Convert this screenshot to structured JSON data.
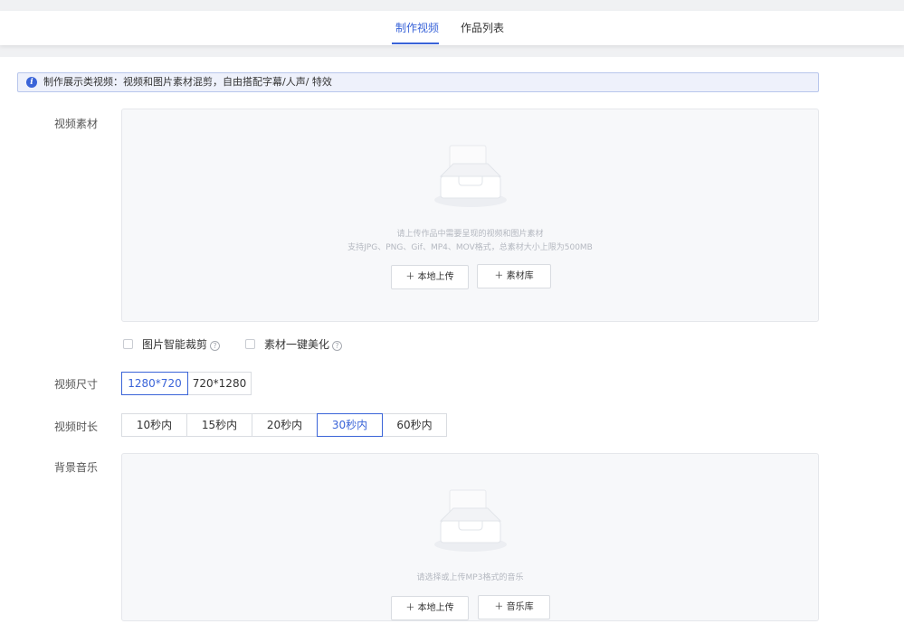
{
  "tabs": [
    {
      "label": "制作视频",
      "active": true
    },
    {
      "label": "作品列表",
      "active": false
    }
  ],
  "notice": {
    "text": "制作展示类视频：视频和图片素材混剪，自由搭配字幕/人声/ 特效",
    "icon": "info-icon"
  },
  "video_material": {
    "label": "视频素材",
    "hint_line1": "请上传作品中需要呈现的视频和图片素材",
    "hint_line2": "支持JPG、PNG、Gif、MP4、MOV格式，总素材大小上限为500MB",
    "upload_button": "＋ 本地上传",
    "library_button": "＋ 素材库"
  },
  "options": {
    "smart_crop": "图片智能裁剪",
    "beautify": "素材一键美化"
  },
  "video_size": {
    "label": "视频尺寸",
    "options": [
      "1280*720",
      "720*1280"
    ],
    "selected": "1280*720"
  },
  "video_duration": {
    "label": "视频时长",
    "options": [
      "10秒内",
      "15秒内",
      "20秒内",
      "30秒内",
      "60秒内"
    ],
    "selected": "30秒内"
  },
  "background_music": {
    "label": "背景音乐",
    "hint": "请选择或上传MP3格式的音乐",
    "upload_button": "＋ 本地上传",
    "library_button": "＋ 音乐库"
  },
  "colors": {
    "accent": "#3a64d8",
    "notice_bg": "#eef1fb",
    "upload_bg": "#f7f8fa"
  }
}
